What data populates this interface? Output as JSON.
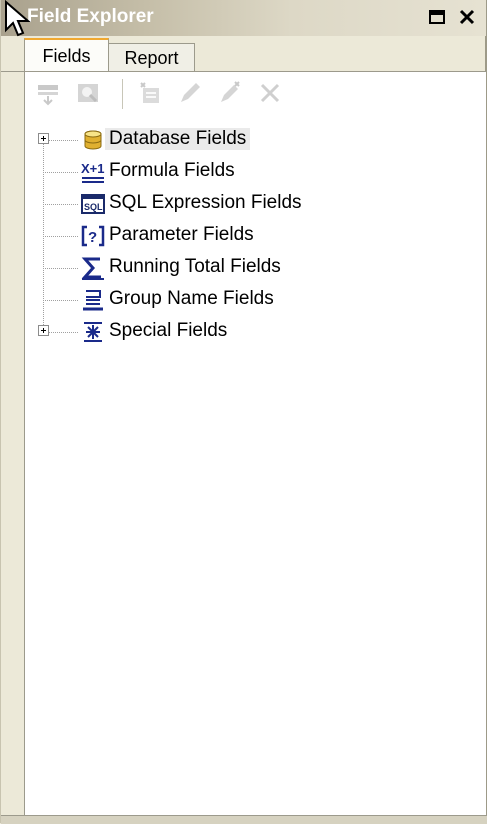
{
  "window": {
    "title": "Field Explorer",
    "restore_icon": "restore-icon",
    "close_icon": "close-icon"
  },
  "tabs": [
    {
      "label": "Fields",
      "active": true
    },
    {
      "label": "Report",
      "active": false
    }
  ],
  "toolbar": {
    "buttons": [
      {
        "icon": "insert-to-report-icon",
        "enabled": false
      },
      {
        "icon": "browse-data-icon",
        "enabled": false
      },
      {
        "icon": "new-field-icon",
        "enabled": false
      },
      {
        "icon": "edit-field-icon",
        "enabled": false
      },
      {
        "icon": "rename-field-icon",
        "enabled": false
      },
      {
        "icon": "delete-field-icon",
        "enabled": false
      }
    ]
  },
  "tree": {
    "items": [
      {
        "label": "Database Fields",
        "icon": "database-icon",
        "expandable": true,
        "selected": true
      },
      {
        "label": "Formula Fields",
        "icon": "formula-icon",
        "expandable": false
      },
      {
        "label": "SQL Expression Fields",
        "icon": "sql-icon",
        "expandable": false
      },
      {
        "label": "Parameter Fields",
        "icon": "parameter-icon",
        "expandable": false
      },
      {
        "label": "Running Total Fields",
        "icon": "sigma-icon",
        "expandable": false
      },
      {
        "label": "Group Name Fields",
        "icon": "group-name-icon",
        "expandable": false
      },
      {
        "label": "Special Fields",
        "icon": "special-fields-icon",
        "expandable": true
      }
    ]
  }
}
